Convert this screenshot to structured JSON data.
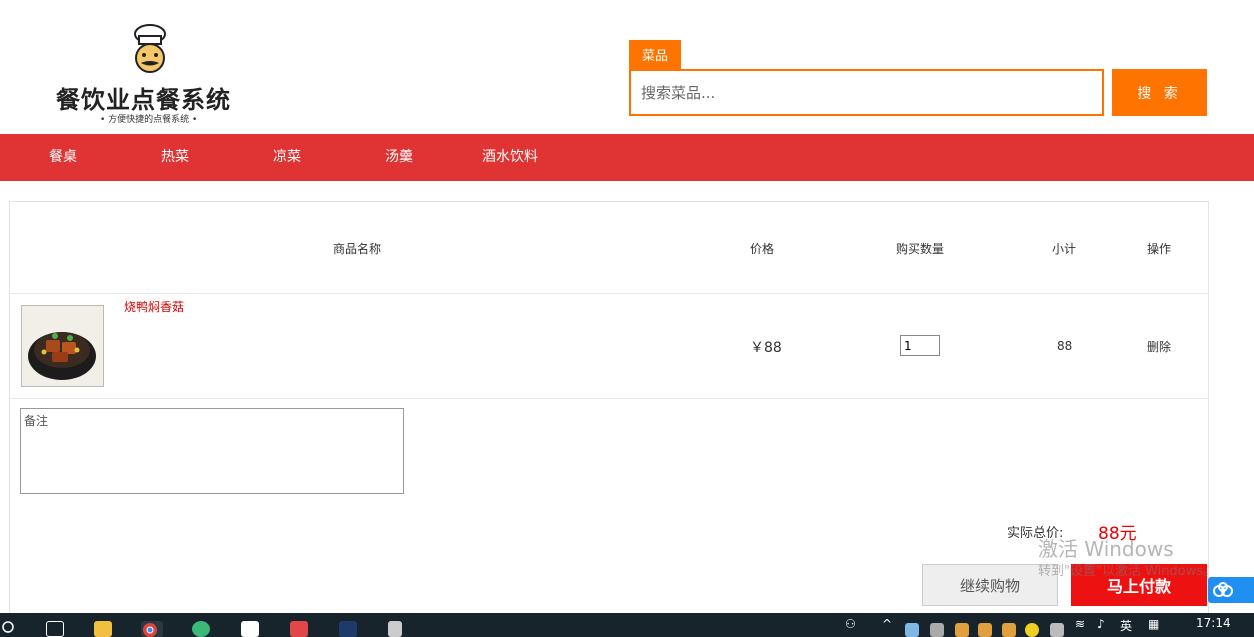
{
  "header": {
    "logo_title": "餐饮业点餐系统",
    "logo_subtitle": "• 方便快捷的点餐系统 •",
    "search_tab": "菜品",
    "search_placeholder": "搜索菜品...",
    "search_button": "搜 索"
  },
  "nav": {
    "items": [
      {
        "label": "餐桌"
      },
      {
        "label": "热菜"
      },
      {
        "label": "凉菜"
      },
      {
        "label": "汤羹"
      },
      {
        "label": "酒水饮料"
      }
    ]
  },
  "cart": {
    "columns": [
      "商品名称",
      "价格",
      "购买数量",
      "小计",
      "操作"
    ],
    "items": [
      {
        "name": "烧鸭焖香菇",
        "price": "￥88",
        "quantity": "1",
        "subtotal": "88",
        "action": "删除"
      }
    ],
    "note_placeholder": "备注",
    "total_label": "实际总价:",
    "total_value": "88元",
    "continue_button": "继续购物",
    "pay_button": "马上付款"
  },
  "watermark": {
    "line1": "激活 Windows",
    "line2": "转到\"设置\"以激活 Windows。"
  },
  "taskbar": {
    "tray_lang": "英",
    "clock": "17:14"
  },
  "colors": {
    "accent": "#ff7300",
    "nav": "#e03434",
    "pay": "#ee1111",
    "price_red": "#cc0000"
  }
}
